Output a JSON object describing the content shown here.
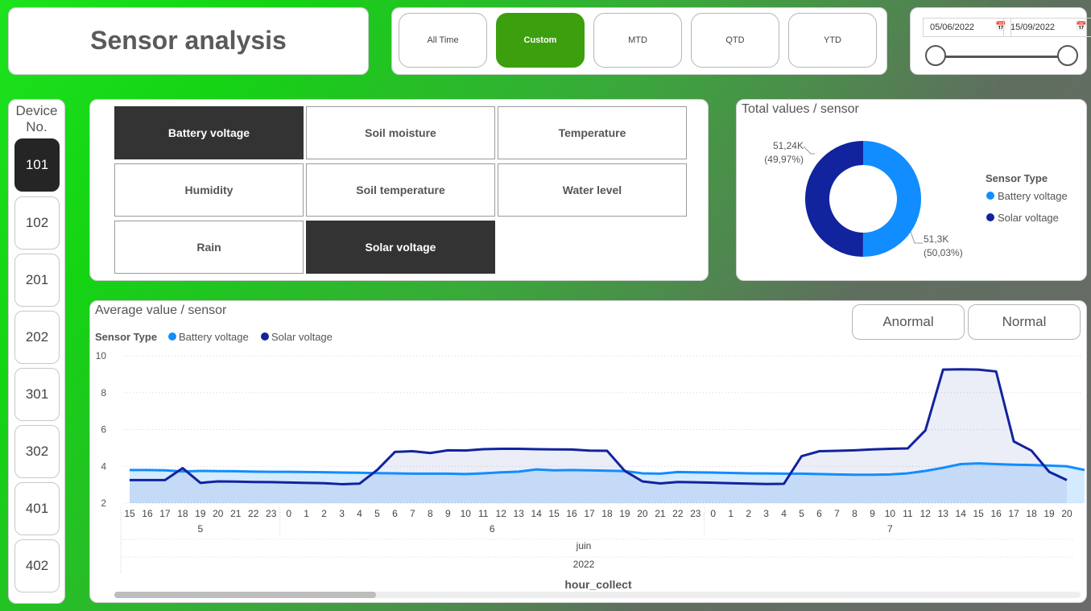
{
  "title": "Sensor analysis",
  "periods": [
    {
      "label": "All Time",
      "active": false
    },
    {
      "label": "Custom",
      "active": true
    },
    {
      "label": "MTD",
      "active": false
    },
    {
      "label": "QTD",
      "active": false
    },
    {
      "label": "YTD",
      "active": false
    }
  ],
  "date_range": {
    "start": "05/06/2022",
    "end": "15/09/2022",
    "calendar_icon": "calendar-icon"
  },
  "device_filter": {
    "title_line1": "Device",
    "title_line2": "No.",
    "devices": [
      "101",
      "102",
      "201",
      "202",
      "301",
      "302",
      "401",
      "402"
    ],
    "selected": "101"
  },
  "sensor_types": [
    {
      "label": "Battery voltage",
      "selected": true
    },
    {
      "label": "Soil moisture",
      "selected": false
    },
    {
      "label": "Temperature",
      "selected": false
    },
    {
      "label": "Humidity",
      "selected": false
    },
    {
      "label": "Soil temperature",
      "selected": false
    },
    {
      "label": "Water level",
      "selected": false
    },
    {
      "label": "Rain",
      "selected": false
    },
    {
      "label": "Solar voltage",
      "selected": true
    }
  ],
  "status_buttons": [
    "Anormal",
    "Normal"
  ],
  "colors": {
    "battery": "#118dff",
    "solar": "#12239e",
    "active_period": "#3c9f0e",
    "active_dark": "#252525"
  },
  "chart_data": [
    {
      "type": "pie",
      "title": "Total values / sensor",
      "legend_title": "Sensor Type",
      "legend_position": "right",
      "slices": [
        {
          "name": "Battery voltage",
          "value": 51.3,
          "label": "51,3K",
          "percent_label": "(50,03%)",
          "color": "#118dff"
        },
        {
          "name": "Solar voltage",
          "value": 51.24,
          "label": "51,24K",
          "percent_label": "(49,97%)",
          "color": "#12239e"
        }
      ]
    },
    {
      "type": "area",
      "title": "Average value / sensor",
      "legend_title": "Sensor Type",
      "legend_position": "top-left",
      "xlabel": "hour_collect",
      "ylim": [
        2,
        10
      ],
      "yticks": [
        "2",
        "4",
        "6",
        "8",
        "10"
      ],
      "grid": true,
      "x_hours": [
        "15",
        "16",
        "17",
        "18",
        "19",
        "20",
        "21",
        "22",
        "23",
        "0",
        "1",
        "2",
        "3",
        "4",
        "5",
        "6",
        "7",
        "8",
        "9",
        "10",
        "11",
        "12",
        "13",
        "14",
        "15",
        "16",
        "17",
        "18",
        "19",
        "20",
        "21",
        "22",
        "23",
        "0",
        "1",
        "2",
        "3",
        "4",
        "5",
        "6",
        "7",
        "8",
        "9",
        "10",
        "11",
        "12",
        "13",
        "14",
        "15",
        "16",
        "17",
        "18",
        "19",
        "20"
      ],
      "x_days": [
        {
          "label": "5",
          "start": 0,
          "end": 8
        },
        {
          "label": "6",
          "start": 9,
          "end": 32
        },
        {
          "label": "7",
          "start": 33,
          "end": 53
        }
      ],
      "x_month": "juin",
      "x_year": "2022",
      "series": [
        {
          "name": "Battery voltage",
          "color": "#118dff",
          "values": [
            3.8,
            3.8,
            3.78,
            3.72,
            3.75,
            3.74,
            3.73,
            3.71,
            3.7,
            3.7,
            3.69,
            3.68,
            3.66,
            3.65,
            3.63,
            3.62,
            3.6,
            3.6,
            3.6,
            3.58,
            3.62,
            3.67,
            3.71,
            3.83,
            3.78,
            3.8,
            3.78,
            3.76,
            3.74,
            3.62,
            3.6,
            3.69,
            3.67,
            3.66,
            3.64,
            3.62,
            3.61,
            3.6,
            3.6,
            3.58,
            3.56,
            3.54,
            3.54,
            3.56,
            3.62,
            3.75,
            3.92,
            4.12,
            4.16,
            4.12,
            4.09,
            4.07,
            4.04,
            4.0,
            3.8
          ]
        },
        {
          "name": "Solar voltage",
          "color": "#12239e",
          "values": [
            3.25,
            3.25,
            3.25,
            3.9,
            3.1,
            3.18,
            3.17,
            3.15,
            3.14,
            3.12,
            3.1,
            3.08,
            3.03,
            3.06,
            3.8,
            4.78,
            4.82,
            4.72,
            4.87,
            4.86,
            4.93,
            4.95,
            4.95,
            4.93,
            4.92,
            4.91,
            4.85,
            4.84,
            3.75,
            3.18,
            3.07,
            3.15,
            3.13,
            3.11,
            3.08,
            3.06,
            3.04,
            3.05,
            4.55,
            4.82,
            4.84,
            4.87,
            4.92,
            4.95,
            4.97,
            5.95,
            9.25,
            9.27,
            9.25,
            9.15,
            5.35,
            4.85,
            3.7,
            3.25
          ]
        }
      ]
    }
  ]
}
